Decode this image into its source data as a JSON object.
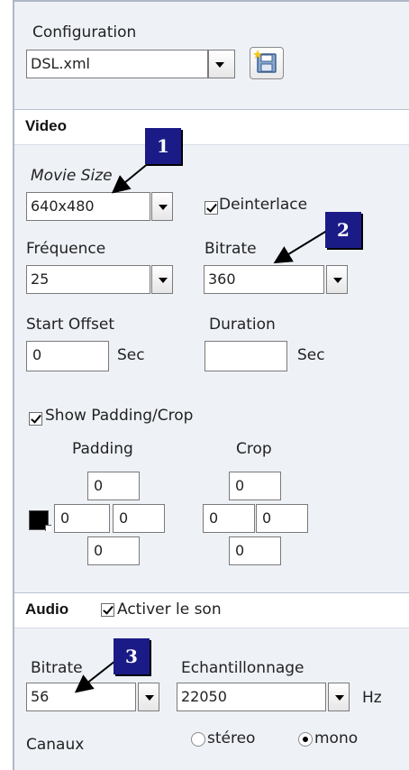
{
  "configuration": {
    "label": "Configuration",
    "file_value": "DSL.xml",
    "save_icon": "save-floppy-icon"
  },
  "video": {
    "title": "Video",
    "movie_size_label": "Movie Size",
    "movie_size_value": "640x480",
    "deinterlace_label": "Deinterlace",
    "deinterlace_checked": true,
    "frequence_label": "Fréquence",
    "frequence_value": "25",
    "bitrate_label": "Bitrate",
    "bitrate_value": "360",
    "start_offset_label": "Start Offset",
    "start_offset_value": "0",
    "start_offset_unit": "Sec",
    "duration_label": "Duration",
    "duration_value": "",
    "duration_unit": "Sec",
    "show_padding_crop_label": "Show Padding/Crop",
    "show_padding_crop_checked": true,
    "padding": {
      "label": "Padding",
      "top": "0",
      "left": "0",
      "right": "0",
      "bottom": "0",
      "color": "#000000"
    },
    "crop": {
      "label": "Crop",
      "top": "0",
      "left": "0",
      "right": "0",
      "bottom": "0"
    }
  },
  "audio": {
    "title": "Audio",
    "activer_label": "Activer le son",
    "activer_checked": true,
    "bitrate_label": "Bitrate",
    "bitrate_value": "56",
    "echantillonnage_label": "Echantillonnage",
    "echantillonnage_value": "22050",
    "hz_unit": "Hz",
    "canaux_label": "Canaux",
    "stereo_label": "stéreo",
    "mono_label": "mono",
    "selected_channel": "mono"
  },
  "callouts": [
    "1",
    "2",
    "3"
  ],
  "colors": {
    "panel_bg": "#eef1f6",
    "callout_bg": "#1b1b87"
  }
}
